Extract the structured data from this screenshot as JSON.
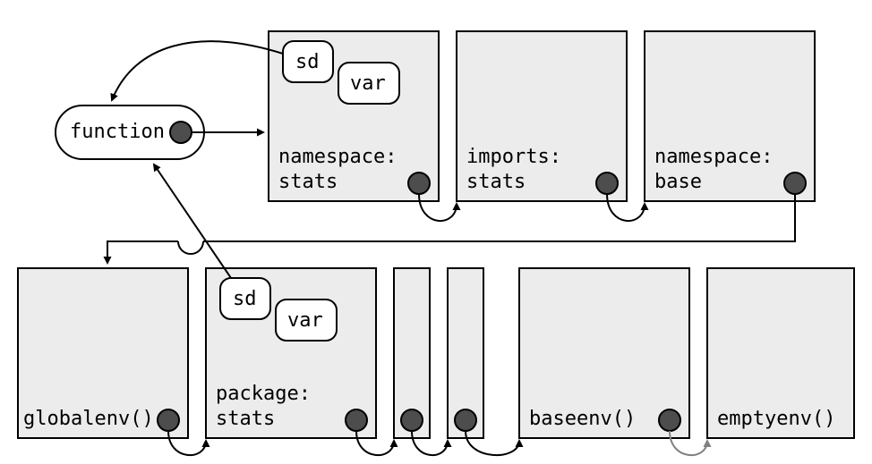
{
  "diagram": {
    "function_label": "function",
    "top_row": {
      "namespace_stats": {
        "label1": "namespace:",
        "label2": "stats",
        "inner1": "sd",
        "inner2": "var"
      },
      "imports_stats": {
        "label1": "imports:",
        "label2": "stats"
      },
      "namespace_base": {
        "label1": "namespace:",
        "label2": "base"
      }
    },
    "bottom_row": {
      "globalenv": {
        "label": "globalenv()"
      },
      "package_stats": {
        "label1": "package:",
        "label2": "stats",
        "inner1": "sd",
        "inner2": "var"
      },
      "baseenv": {
        "label": "baseenv()"
      },
      "emptyenv": {
        "label": "emptyenv()"
      }
    }
  }
}
